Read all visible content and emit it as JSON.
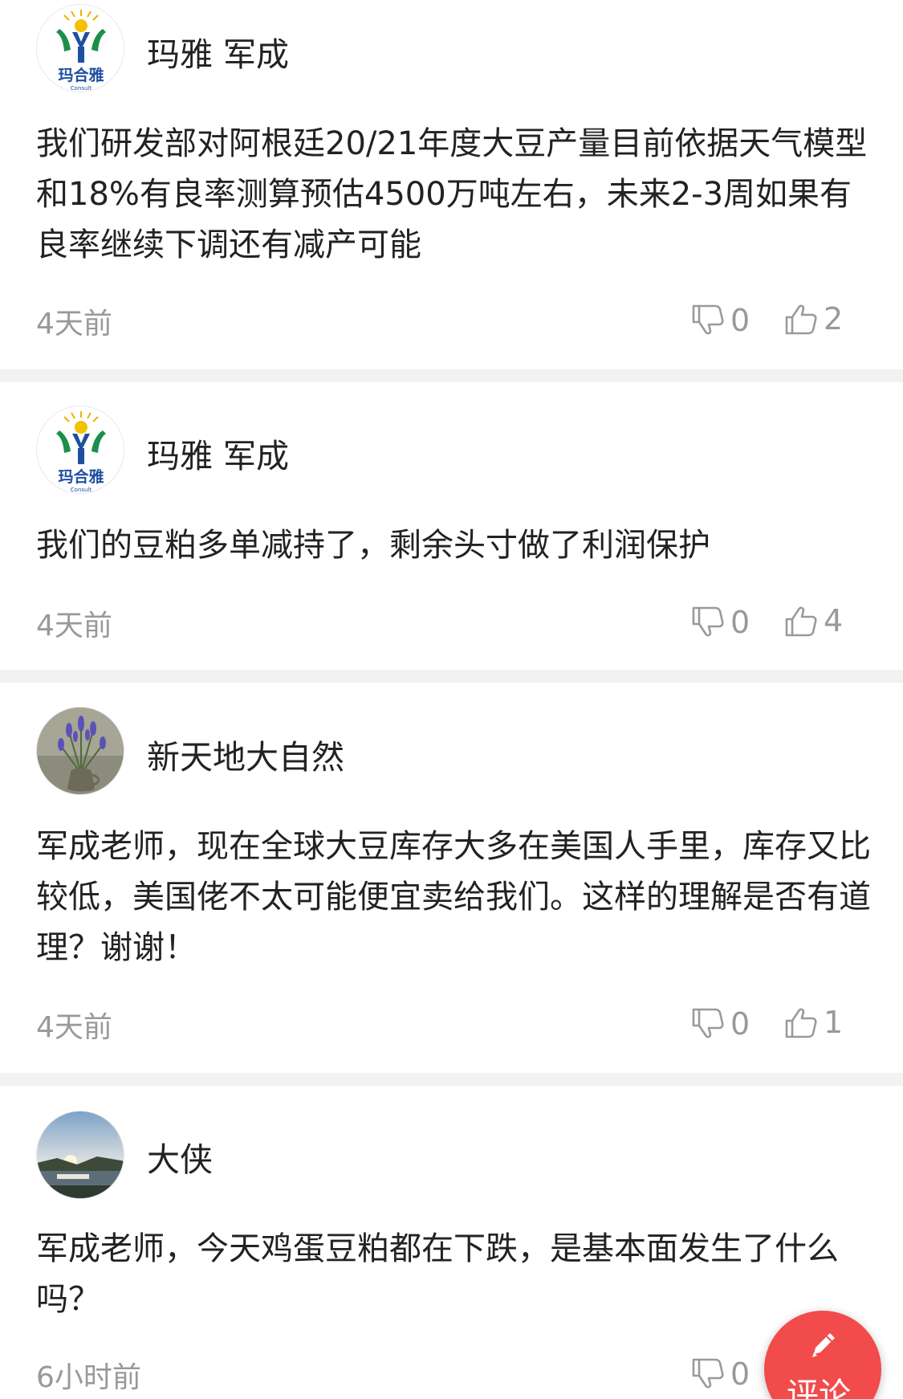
{
  "comments": [
    {
      "author": "玛雅 军成",
      "avatar": "maya-logo",
      "text": "我们研发部对阿根廷20/21年度大豆产量目前依据天气模型和18%有良率测算预估4500万吨左右，未来2-3周如果有良率继续下调还有减产可能",
      "time": "4天前",
      "dislikes": "0",
      "likes": "2"
    },
    {
      "author": "玛雅 军成",
      "avatar": "maya-logo",
      "text": "我们的豆粕多单减持了，剩余头寸做了利润保护",
      "time": "4天前",
      "dislikes": "0",
      "likes": "4"
    },
    {
      "author": "新天地大自然",
      "avatar": "flower-vase",
      "text": "军成老师，现在全球大豆库存大多在美国人手里，库存又比较低，美国佬不太可能便宜卖给我们。这样的理解是否有道理？谢谢！",
      "time": "4天前",
      "dislikes": "0",
      "likes": "1"
    },
    {
      "author": "大侠",
      "avatar": "sunset-landscape",
      "text": "军成老师，今天鸡蛋豆粕都在下跌，是基本面发生了什么吗？",
      "time": "6小时前",
      "dislikes": "0",
      "likes": ""
    }
  ],
  "fab": {
    "label": "评论",
    "icon": "pen-icon",
    "color": "#f24b4b"
  },
  "logo_text": "玛合雅"
}
